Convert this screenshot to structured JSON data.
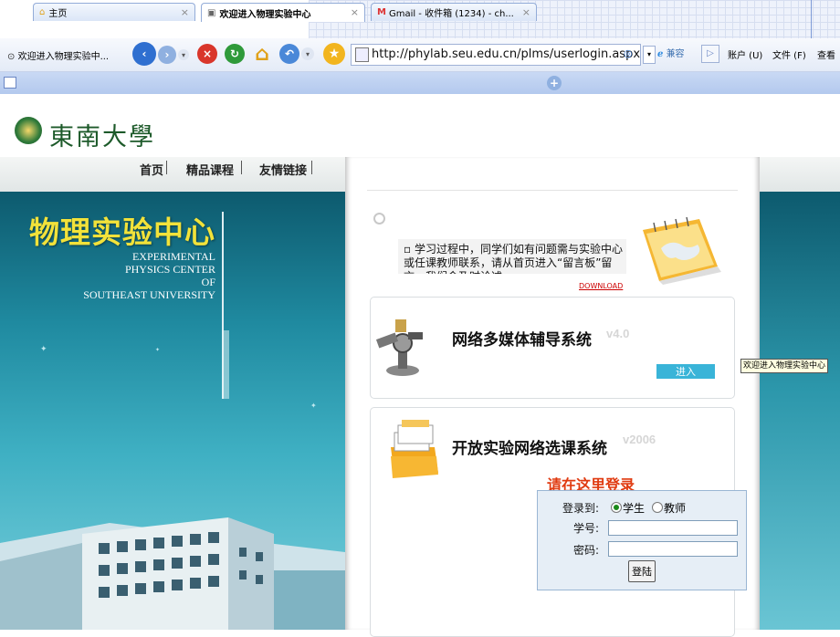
{
  "browser": {
    "window_title": "欢迎进入物理实验中...",
    "address": "http://phylab.seu.edu.cn/plms/userlogin.aspx",
    "compat_label": "兼容",
    "menu": [
      "账户 (U)",
      "文件 (F)",
      "查看"
    ],
    "tabs": [
      {
        "label": "主页"
      },
      {
        "label": "欢迎进入物理实验中心"
      },
      {
        "label": "Gmail - 收件箱 (1234) - ch..."
      }
    ],
    "tab_close": "×"
  },
  "site": {
    "logo_text": "東南大學",
    "nav": [
      "首页",
      "精品课程",
      "友情链接"
    ],
    "title_cn": "物理实验中心",
    "title_en": [
      "EXPERIMENTAL",
      "PHYSICS CENTER",
      "OF",
      "SOUTHEAST UNIVERSITY"
    ]
  },
  "notice": {
    "bullet": "▫",
    "text": "学习过程中，同学们如有问题需与实验中心或任课教师联系，请从首页进入“留言板”留言，我们会及时论述。",
    "download": "DOWNLOAD"
  },
  "systems": [
    {
      "title": "网络多媒体辅导系统",
      "version": "v4.0",
      "button": "进入"
    },
    {
      "title": "开放实验网络选课系统",
      "version": "v2006"
    }
  ],
  "tooltip": "欢迎进入物理实验中心",
  "login": {
    "heading": "请在这里登录",
    "login_to_label": "登录到:",
    "role_options": [
      "学生",
      "教师"
    ],
    "selected_role": "学生",
    "id_label": "学号:",
    "password_label": "密码:",
    "submit": "登陆"
  }
}
